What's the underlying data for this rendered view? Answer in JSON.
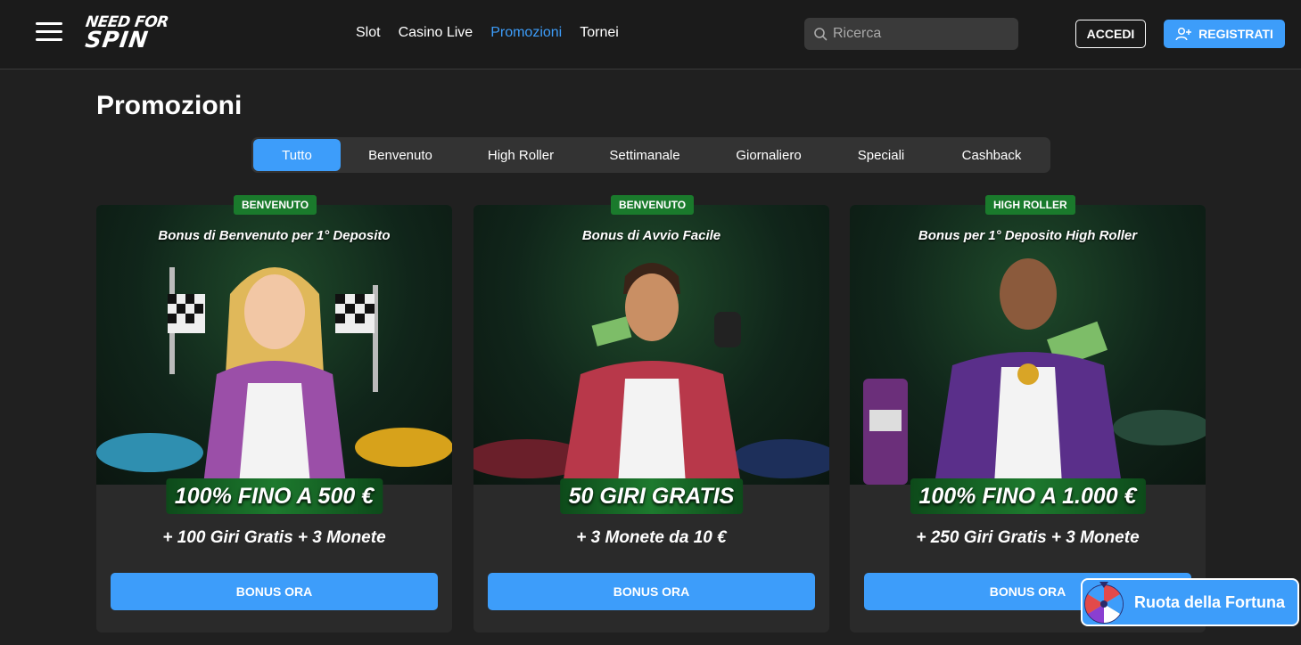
{
  "header": {
    "logo_line1": "NEED FOR",
    "logo_line2": "SPIN",
    "nav": [
      "Slot",
      "Casino Live",
      "Promozioni",
      "Tornei"
    ],
    "active_nav": "Promozioni",
    "search_placeholder": "Ricerca",
    "login_label": "ACCEDI",
    "register_label": "REGISTRATI"
  },
  "page": {
    "title": "Promozioni"
  },
  "tabs": [
    "Tutto",
    "Benvenuto",
    "High Roller",
    "Settimanale",
    "Giornaliero",
    "Speciali",
    "Cashback"
  ],
  "active_tab": "Tutto",
  "cards": [
    {
      "badge": "BENVENUTO",
      "title": "Bonus di Benvenuto per 1° Deposito",
      "headline": "100% FINO A 500 €",
      "sub": "+ 100 Giri Gratis + 3 Monete",
      "button": "BONUS ORA"
    },
    {
      "badge": "BENVENUTO",
      "title": "Bonus di Avvio Facile",
      "headline": "50 GIRI GRATIS",
      "sub": "+ 3 Monete da 10 €",
      "button": "BONUS ORA"
    },
    {
      "badge": "HIGH ROLLER",
      "title": "Bonus per 1° Deposito High Roller",
      "headline": "100% FINO A 1.000 €",
      "sub": "+ 250 Giri Gratis + 3 Monete",
      "button": "BONUS ORA"
    }
  ],
  "wheel": {
    "label": "Ruota della Fortuna"
  },
  "colors": {
    "accent": "#3d9dfa",
    "badge_green": "#1a7a2c",
    "background": "#202020"
  }
}
